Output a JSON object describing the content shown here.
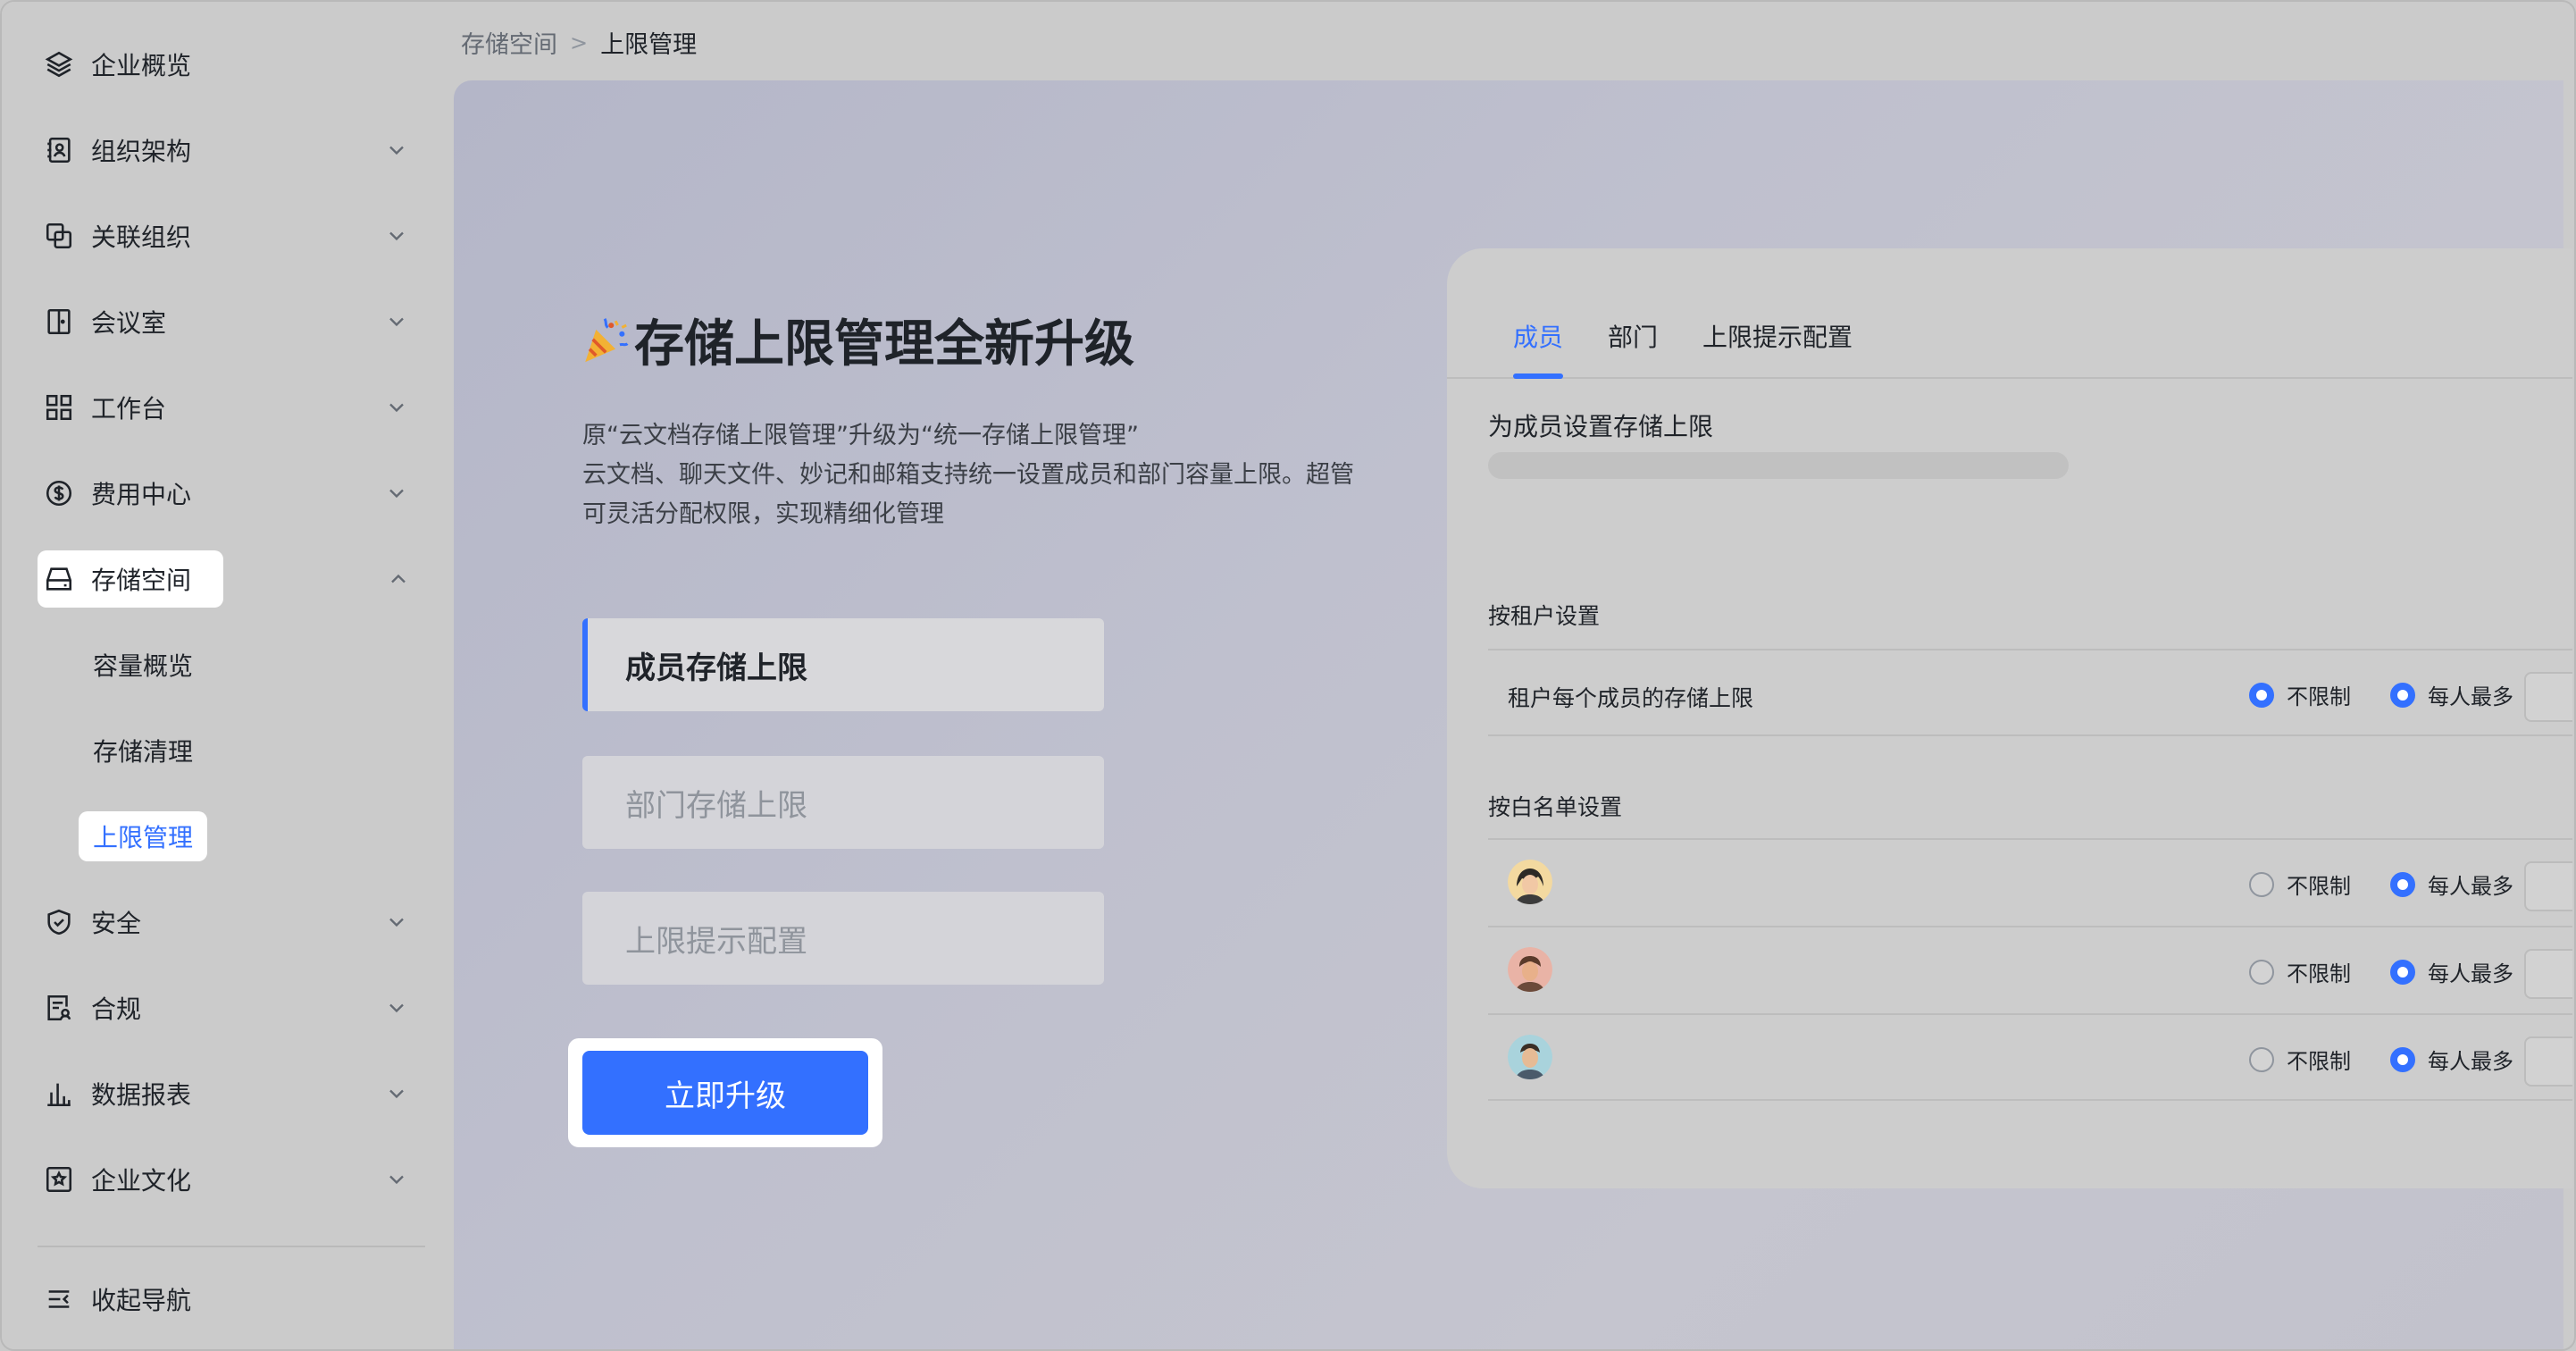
{
  "breadcrumb": {
    "parent": "存储空间",
    "separator": ">",
    "current": "上限管理"
  },
  "sidebar": {
    "items": [
      {
        "label": "企业概览",
        "icon": "layers-icon"
      },
      {
        "label": "组织架构",
        "icon": "org-chart-icon"
      },
      {
        "label": "关联组织",
        "icon": "link-org-icon"
      },
      {
        "label": "会议室",
        "icon": "door-icon"
      },
      {
        "label": "工作台",
        "icon": "grid-icon"
      },
      {
        "label": "费用中心",
        "icon": "dollar-icon"
      },
      {
        "label": "存储空间",
        "icon": "drive-icon"
      },
      {
        "label": "安全",
        "icon": "shield-icon"
      },
      {
        "label": "合规",
        "icon": "compliance-icon"
      },
      {
        "label": "数据报表",
        "icon": "bar-chart-icon"
      },
      {
        "label": "企业文化",
        "icon": "culture-icon"
      }
    ],
    "storage_sub": [
      "容量概览",
      "存储清理",
      "上限管理"
    ],
    "collapse_label": "收起导航"
  },
  "promo": {
    "title": "存储上限管理全新升级",
    "desc_line1": "原“云文档存储上限管理”升级为“统一存储上限管理”",
    "desc_line2": "云文档、聊天文件、妙记和邮箱支持统一设置成员和部门容量上限。超管",
    "desc_line3": "可灵活分配权限，实现精细化管理",
    "features": [
      "成员存储上限",
      "部门存储上限",
      "上限提示配置"
    ],
    "upgrade_label": "立即升级"
  },
  "preview": {
    "tabs": [
      "成员",
      "部门",
      "上限提示配置"
    ],
    "section_title": "为成员设置存储上限",
    "tenant_group": "按租户设置",
    "tenant_row_label": "租户每个成员的存储上限",
    "whitelist_group": "按白名单设置",
    "option_unlimited": "不限制",
    "option_max": "每人最多"
  },
  "colors": {
    "accent": "#3370ff"
  }
}
